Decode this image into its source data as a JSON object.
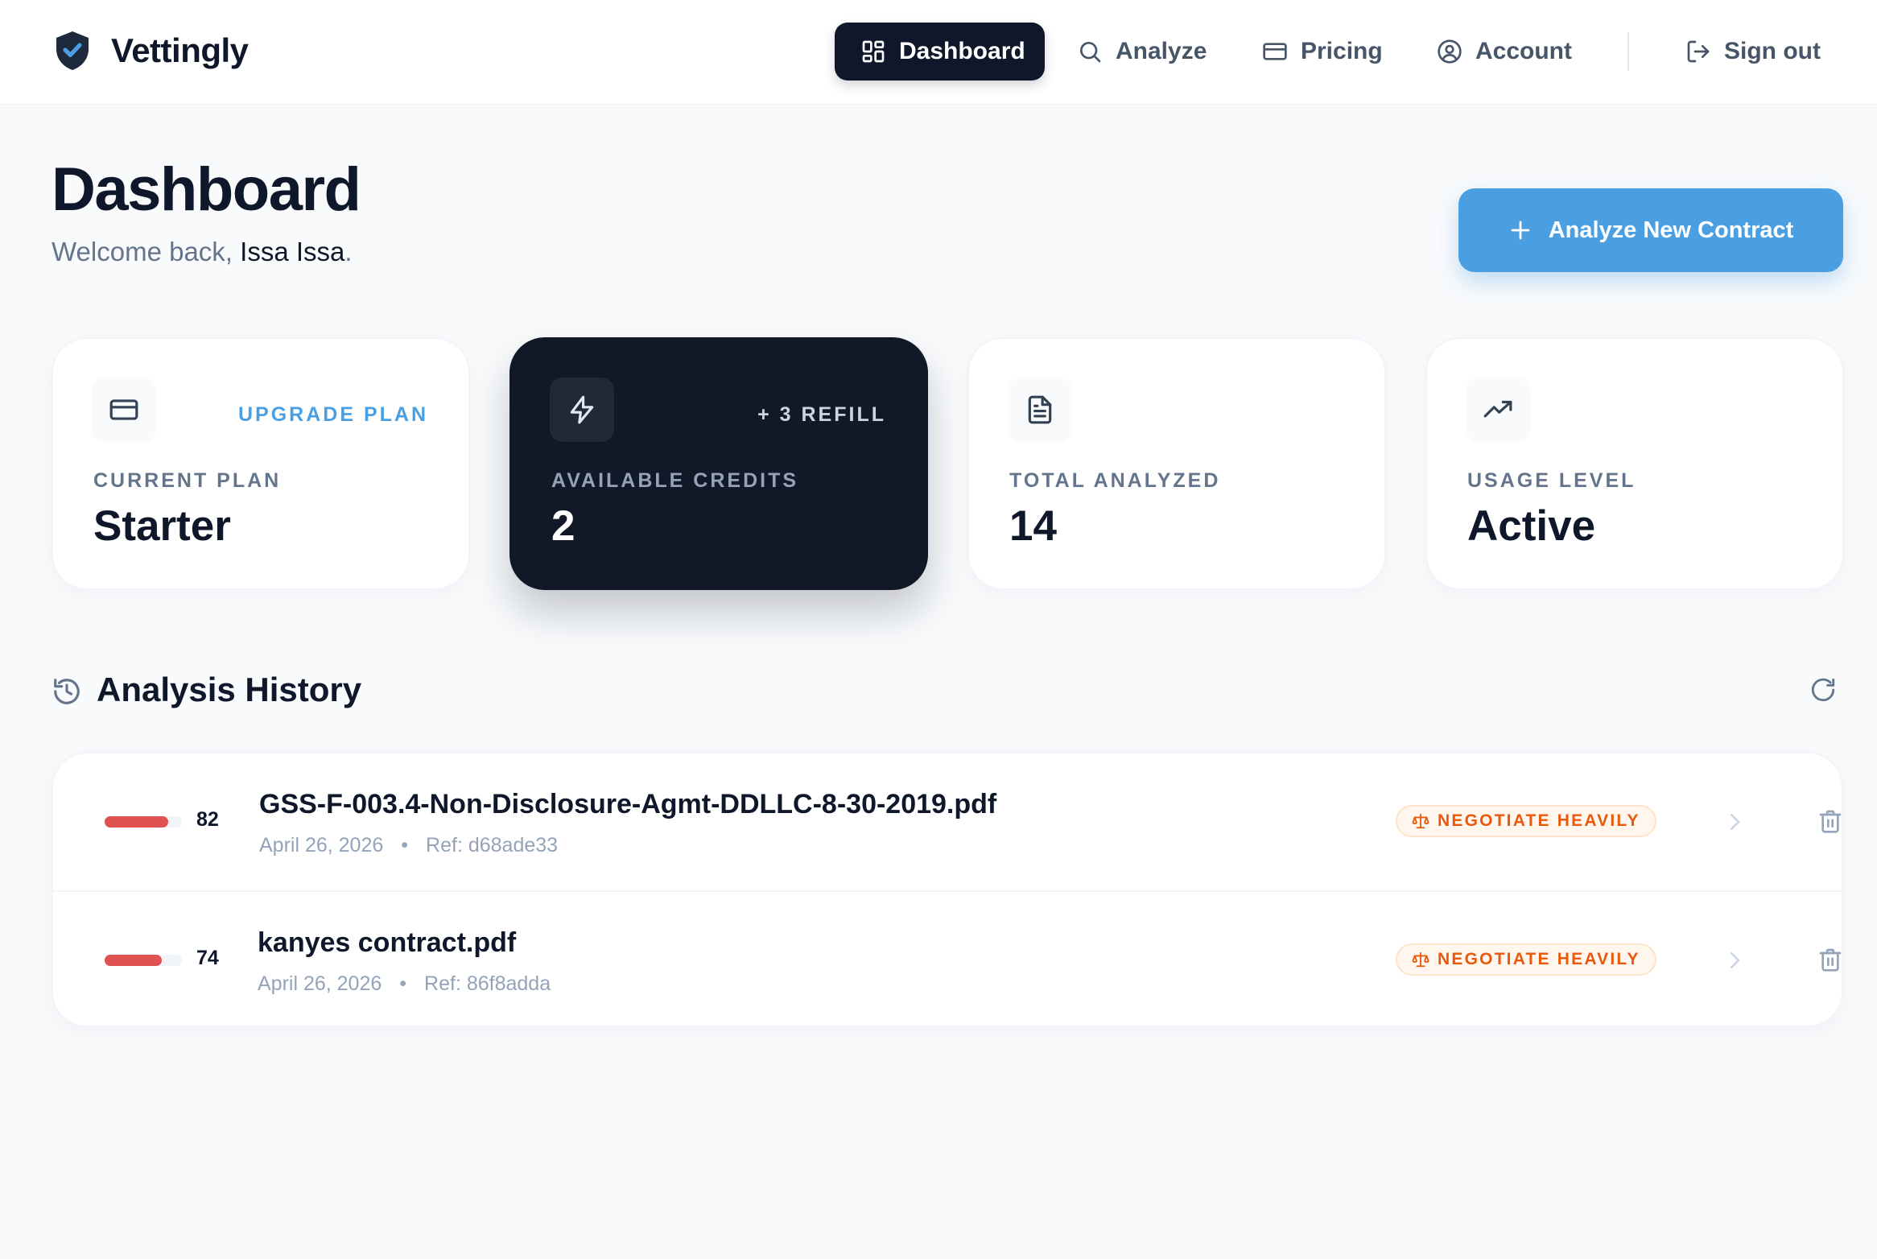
{
  "brand": {
    "name": "Vettingly",
    "icon": "shield-check-icon"
  },
  "nav": {
    "dashboard": "Dashboard",
    "analyze": "Analyze",
    "pricing": "Pricing",
    "account": "Account",
    "sign_out": "Sign out"
  },
  "header": {
    "title": "Dashboard",
    "welcome_prefix": "Welcome back,",
    "user_name": "Issa Issa",
    "welcome_suffix": ".",
    "cta_label": "Analyze New Contract"
  },
  "cards": [
    {
      "icon": "credit-card-icon",
      "action": "UPGRADE PLAN",
      "label": "CURRENT PLAN",
      "value": "Starter"
    },
    {
      "icon": "lightning-icon",
      "action": "+ 3 REFILL",
      "label": "AVAILABLE CREDITS",
      "value": "2"
    },
    {
      "icon": "document-icon",
      "action": "",
      "label": "TOTAL ANALYZED",
      "value": "14"
    },
    {
      "icon": "trending-up-icon",
      "action": "",
      "label": "USAGE LEVEL",
      "value": "Active"
    }
  ],
  "history": {
    "title": "Analysis History",
    "rows": [
      {
        "score": "82",
        "score_fraction": 0.82,
        "file_name": "GSS-F-003.4-Non-Disclosure-Agmt-DDLLC-8-30-2019.pdf",
        "date": "April 26, 2026",
        "separator": "•",
        "ref": "Ref: d68ade33",
        "verdict": "NEGOTIATE HEAVILY"
      },
      {
        "score": "74",
        "score_fraction": 0.74,
        "file_name": "kanyes contract.pdf",
        "date": "April 26, 2026",
        "separator": "•",
        "ref": "Ref: 86f8adda",
        "verdict": "NEGOTIATE HEAVILY"
      }
    ]
  },
  "colors": {
    "accent": "#4a9fe2",
    "dark": "#0f172a",
    "score_bar": "#e05252",
    "verdict": "#ea580c"
  }
}
